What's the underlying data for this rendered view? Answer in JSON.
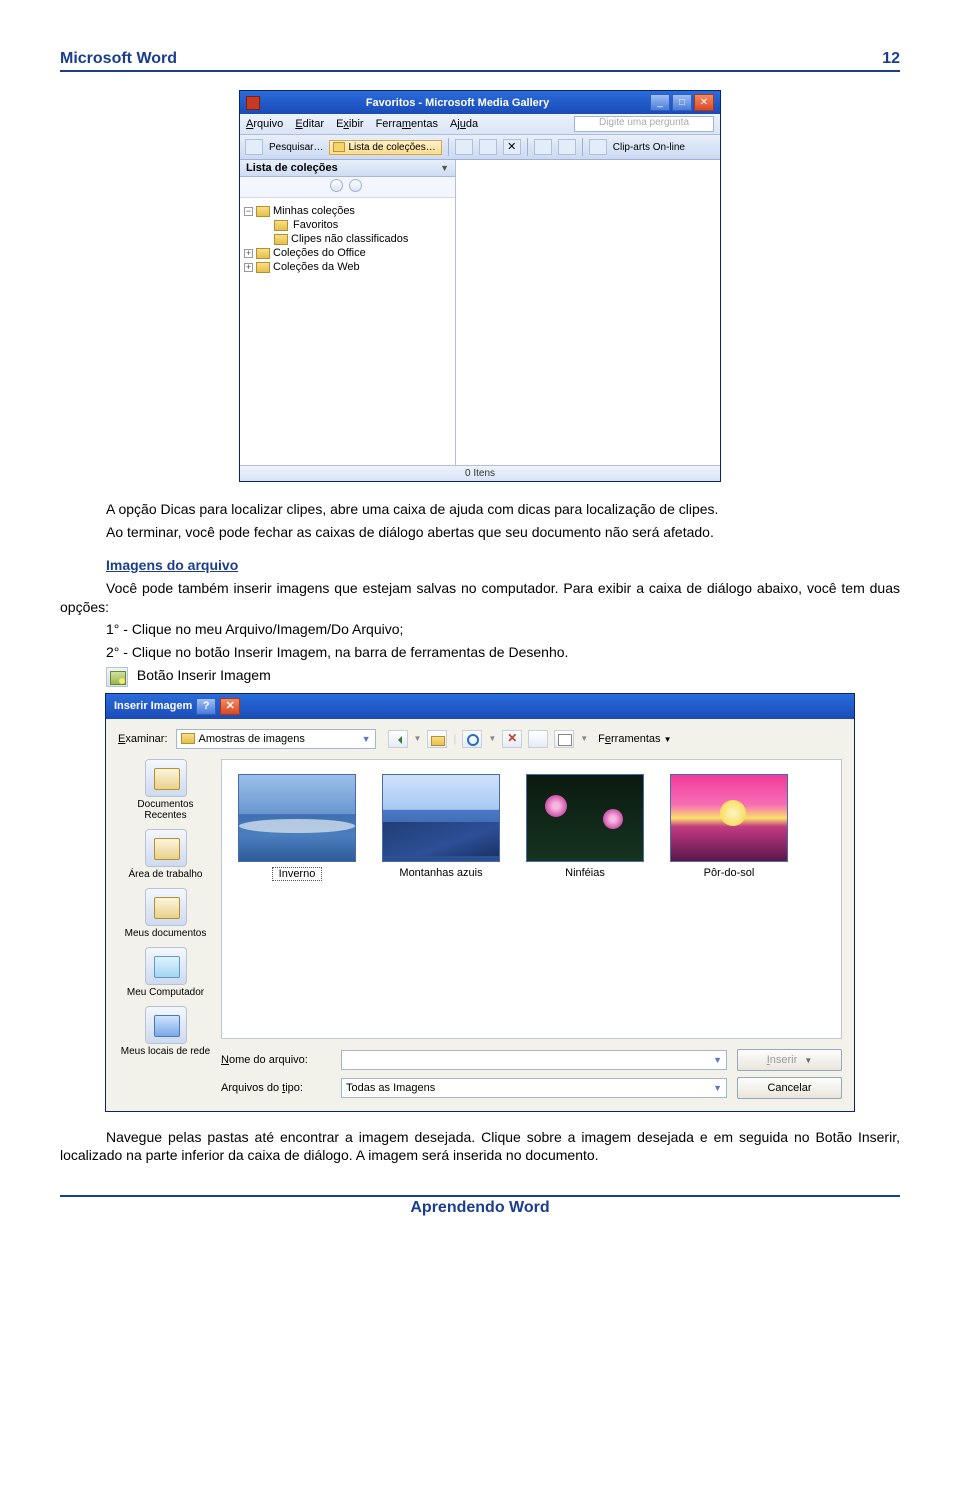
{
  "header": {
    "title": "Microsoft Word",
    "page": "12"
  },
  "footer": {
    "title": "Aprendendo Word"
  },
  "media_gallery": {
    "title": "Favoritos - Microsoft Media Gallery",
    "menu": {
      "arquivo": "Arquivo",
      "editar": "Editar",
      "exibir": "Exibir",
      "ferramentas": "Ferramentas",
      "ajuda": "Ajuda"
    },
    "ask_placeholder": "Digite uma pergunta",
    "toolbar": {
      "pesquisar": "Pesquisar…",
      "lista": "Lista de coleções…",
      "cliparts": "Clip-arts On-line"
    },
    "side_title": "Lista de coleções",
    "tree": {
      "minhas": "Minhas coleções",
      "favoritos": "Favoritos",
      "clipes_nc": "Clipes não classificados",
      "office": "Coleções do Office",
      "web": "Coleções da Web"
    },
    "status": "0 Itens"
  },
  "body_text": {
    "p1": "A opção Dicas para localizar clipes, abre uma caixa de ajuda com dicas para localização de clipes.",
    "p2": "Ao terminar, você pode fechar as caixas de diálogo abertas que seu documento não será afetado.",
    "h_link": "Imagens do arquivo",
    "p3": "Você pode também inserir imagens que estejam salvas no computador. Para exibir a caixa de diálogo abaixo, você tem duas opções:",
    "li1": "1° - Clique no meu Arquivo/Imagem/Do Arquivo;",
    "li2": "2° - Clique no botão Inserir Imagem, na barra de ferramentas de Desenho.",
    "btn_label": "Botão Inserir Imagem",
    "p4": "Navegue pelas pastas até encontrar a imagem desejada. Clique sobre a imagem desejada e em seguida no Botão Inserir, localizado na parte inferior da caixa de diálogo. A imagem será inserida no documento."
  },
  "insert_image": {
    "title": "Inserir Imagem",
    "examinar_label": "Examinar:",
    "examinar_value": "Amostras de imagens",
    "ferramentas": "Ferramentas",
    "places": {
      "recent": "Documentos Recentes",
      "desktop": "Área de trabalho",
      "mydocs": "Meus documentos",
      "mycomp": "Meu Computador",
      "netloc": "Meus locais de rede"
    },
    "thumbs": {
      "t1": "Inverno",
      "t2": "Montanhas azuis",
      "t3": "Ninféias",
      "t4": "Pôr-do-sol"
    },
    "fields": {
      "nome_label": "Nome do arquivo:",
      "nome_value": "",
      "tipo_label": "Arquivos do tipo:",
      "tipo_value": "Todas as Imagens"
    },
    "buttons": {
      "inserir": "Inserir",
      "cancelar": "Cancelar"
    }
  }
}
